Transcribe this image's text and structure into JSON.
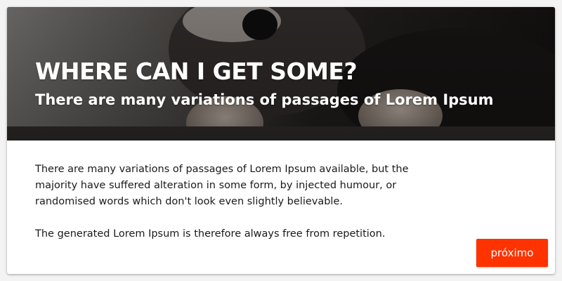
{
  "hero": {
    "title": "WHERE CAN I GET SOME?",
    "subtitle": "There are many variations of passages of Lorem Ipsum"
  },
  "content": {
    "paragraphs": [
      "There are many variations of passages of Lorem Ipsum available, but the majority have suffered alteration in some form, by injected humour, or randomised words which don't look even slightly believable.",
      "The generated Lorem Ipsum is therefore always free from repetition."
    ]
  },
  "actions": {
    "next_label": "próximo"
  },
  "colors": {
    "accent": "#ff3300",
    "card_background": "#ffffff",
    "page_background": "#f3f3f3"
  }
}
